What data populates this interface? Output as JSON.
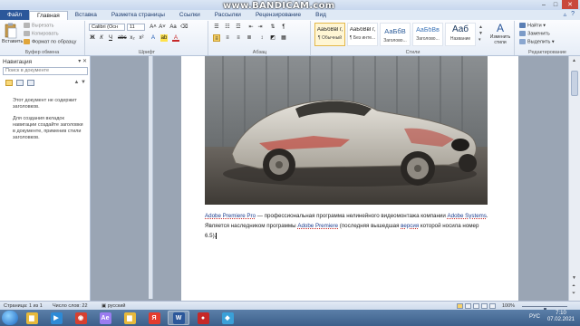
{
  "watermark": "www.BANDICAM.com",
  "window_controls": {
    "minimize": "–",
    "maximize": "□",
    "close": "✕"
  },
  "tabs": [
    {
      "label": "Файл",
      "kind": "file"
    },
    {
      "label": "Главная",
      "kind": "active"
    },
    {
      "label": "Вставка",
      "kind": "normal"
    },
    {
      "label": "Разметка страницы",
      "kind": "normal"
    },
    {
      "label": "Ссылки",
      "kind": "normal"
    },
    {
      "label": "Рассылки",
      "kind": "normal"
    },
    {
      "label": "Рецензирование",
      "kind": "normal"
    },
    {
      "label": "Вид",
      "kind": "normal"
    }
  ],
  "ribbon": {
    "clipboard": {
      "paste": "Вставить",
      "cut": "Вырезать",
      "copy": "Копировать",
      "format_painter": "Формат по образцу",
      "label": "Буфер обмена"
    },
    "font": {
      "name": "Calibri (Осн",
      "size": "11",
      "bold": "Ж",
      "italic": "К",
      "underline": "Ч",
      "label": "Шрифт"
    },
    "paragraph": {
      "label": "Абзац"
    },
    "styles": {
      "label": "Стили",
      "items": [
        {
          "sample": "АаБбВвГг,",
          "name": "¶ Обычный",
          "selected": true
        },
        {
          "sample": "АаБбВвГг,",
          "name": "¶ Без инте...",
          "selected": false
        },
        {
          "sample": "АаБбВ",
          "name": "Заголово...",
          "selected": false
        },
        {
          "sample": "АаБбВв",
          "name": "Заголово...",
          "selected": false
        },
        {
          "sample": "Ааб",
          "name": "Название",
          "selected": false
        }
      ],
      "change_styles": "Изменить стили"
    },
    "editing": {
      "label": "Редактирование",
      "find": "Найти",
      "replace": "Заменить",
      "select": "Выделить"
    }
  },
  "navigation": {
    "title": "Навигация",
    "search_placeholder": "Поиск в документе",
    "message_1": "Этот документ не содержит заголовков.",
    "message_2": "Для создания вкладок навигации создайте заголовки в документе, применив стили заголовков."
  },
  "document": {
    "paragraph": {
      "link1": "Adobe Premiere Pro",
      "text1": " — профессиональная программа нелинейного видеомонтажа компании ",
      "link2": "Adobe Systems",
      "text2": ". Является наследником программы ",
      "link3": "Adobe Premiere",
      "text3": " (последняя вышедшая ",
      "link4": "версия",
      "text4": " которой носила номер 6.5)."
    }
  },
  "statusbar": {
    "page": "Страница: 1 из 1",
    "words": "Число слов: 22",
    "language": "русский",
    "zoom": "100%",
    "zoom_level_fraction": 0.5
  },
  "taskbar": {
    "apps": [
      {
        "name": "explorer-icon",
        "color": "#e7b93b",
        "glyph": "▆",
        "active": false
      },
      {
        "name": "media-player-icon",
        "color": "#2d8ad6",
        "glyph": "▶",
        "active": false
      },
      {
        "name": "chrome-icon",
        "color": "#d64030",
        "glyph": "◉",
        "active": false
      },
      {
        "name": "after-effects-icon",
        "color": "#9a7cf0",
        "glyph": "Ae",
        "active": false
      },
      {
        "name": "folder-icon",
        "color": "#e7b93b",
        "glyph": "▆",
        "active": false
      },
      {
        "name": "yandex-icon",
        "color": "#e33b2e",
        "glyph": "Я",
        "active": false
      },
      {
        "name": "word-icon",
        "color": "#2b579a",
        "glyph": "W",
        "active": true
      },
      {
        "name": "bandicam-icon",
        "color": "#c62828",
        "glyph": "●",
        "active": false
      },
      {
        "name": "photo-app-icon",
        "color": "#3aa0d8",
        "glyph": "◆",
        "active": false
      }
    ],
    "lang": "РУС",
    "time": "7:10",
    "date": "07.02.2021"
  }
}
